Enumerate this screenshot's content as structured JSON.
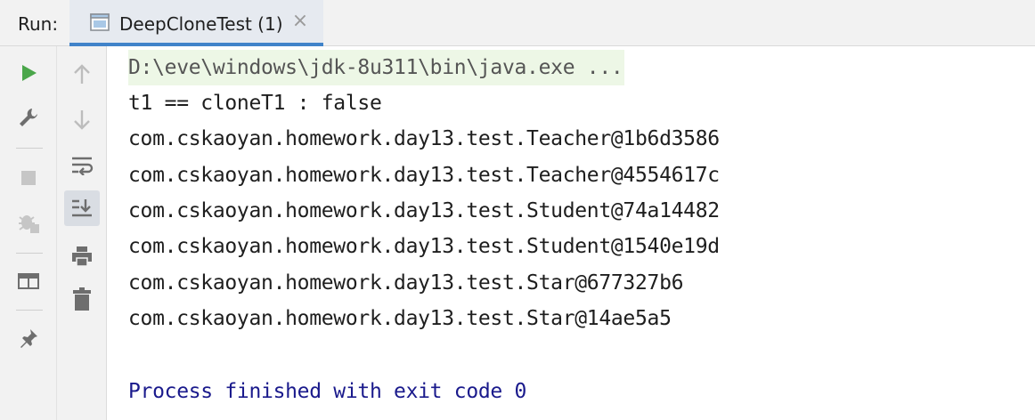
{
  "header": {
    "run_label": "Run:",
    "tab": {
      "title": "DeepCloneTest (1)",
      "close": "×"
    }
  },
  "toolbar_left": {
    "items": [
      "rerun-icon",
      "wrench-icon",
      "stop-icon",
      "debug-attach-icon",
      "layout-icon",
      "pin-icon"
    ]
  },
  "toolbar_right": {
    "items": [
      "arrow-up-icon",
      "arrow-down-icon",
      "soft-wrap-icon",
      "scroll-to-end-icon",
      "print-icon",
      "trash-icon"
    ]
  },
  "console": {
    "command": "D:\\eve\\windows\\jdk-8u311\\bin\\java.exe ...",
    "lines": [
      "t1 == cloneT1 : false",
      "com.cskaoyan.homework.day13.test.Teacher@1b6d3586",
      "com.cskaoyan.homework.day13.test.Teacher@4554617c",
      "com.cskaoyan.homework.day13.test.Student@74a14482",
      "com.cskaoyan.homework.day13.test.Student@1540e19d",
      "com.cskaoyan.homework.day13.test.Star@677327b6",
      "com.cskaoyan.homework.day13.test.Star@14ae5a5"
    ],
    "exit": "Process finished with exit code 0"
  },
  "colors": {
    "run_green": "#4aa64a",
    "tab_underline": "#4083c9",
    "command_bg": "#edf7e6",
    "exit_text": "#1a1a8c"
  }
}
